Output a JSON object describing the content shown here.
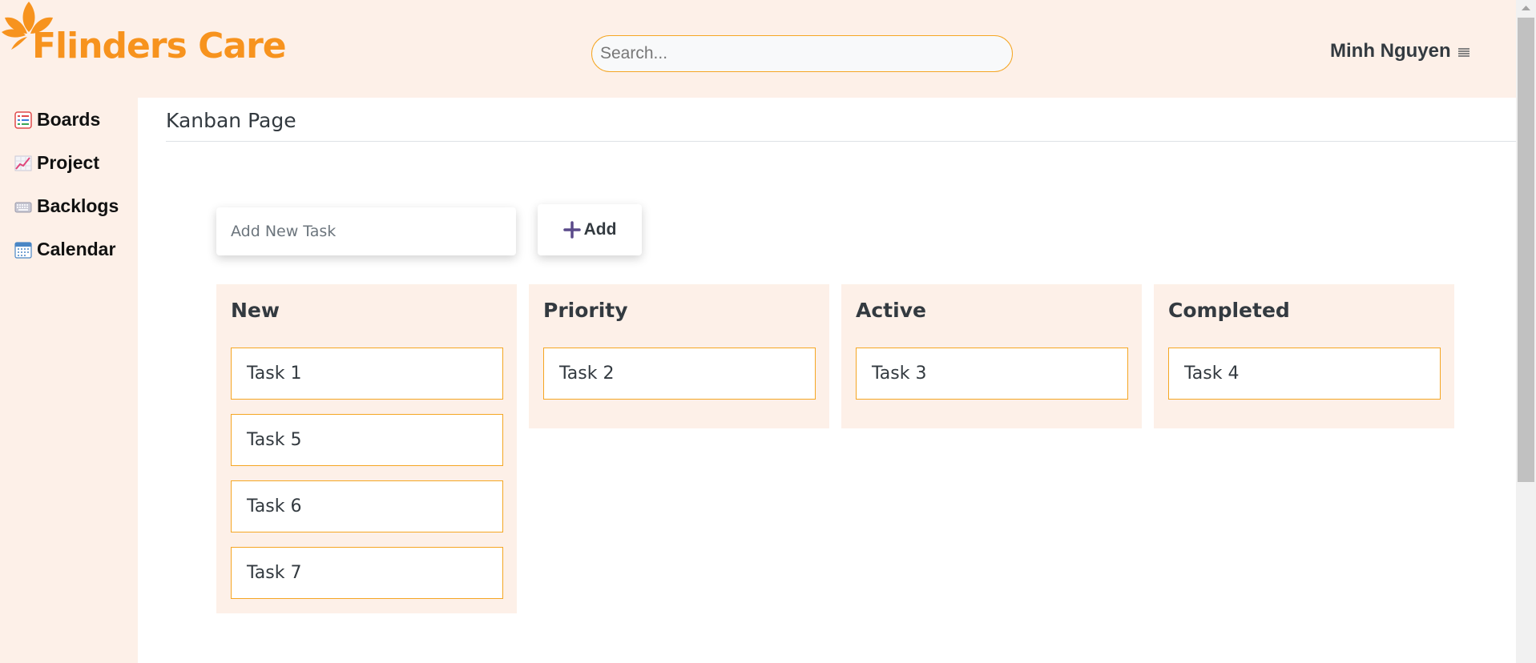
{
  "header": {
    "brand": "Flinders Care",
    "search_placeholder": "Search...",
    "user_name": "Minh Nguyen",
    "menu_icon": "hamburger-icon",
    "brand_color": "#f7931e"
  },
  "sidebar": {
    "items": [
      {
        "label": "Boards",
        "icon": "boards-icon"
      },
      {
        "label": "Project",
        "icon": "chart-icon"
      },
      {
        "label": "Backlogs",
        "icon": "keyboard-icon"
      },
      {
        "label": "Calendar",
        "icon": "calendar-icon"
      }
    ]
  },
  "main": {
    "title": "Kanban Page",
    "new_task_placeholder": "Add New Task",
    "add_label": "Add"
  },
  "board": {
    "columns": [
      {
        "title": "New",
        "tasks": [
          "Task 1",
          "Task 5",
          "Task 6",
          "Task 7"
        ]
      },
      {
        "title": "Priority",
        "tasks": [
          "Task 2"
        ]
      },
      {
        "title": "Active",
        "tasks": [
          "Task 3"
        ]
      },
      {
        "title": "Completed",
        "tasks": [
          "Task 4"
        ]
      }
    ]
  },
  "colors": {
    "background": "#fdf0e8",
    "accent_border": "#f5a623",
    "text": "#333a40",
    "add_icon": "#5a4a8a"
  }
}
